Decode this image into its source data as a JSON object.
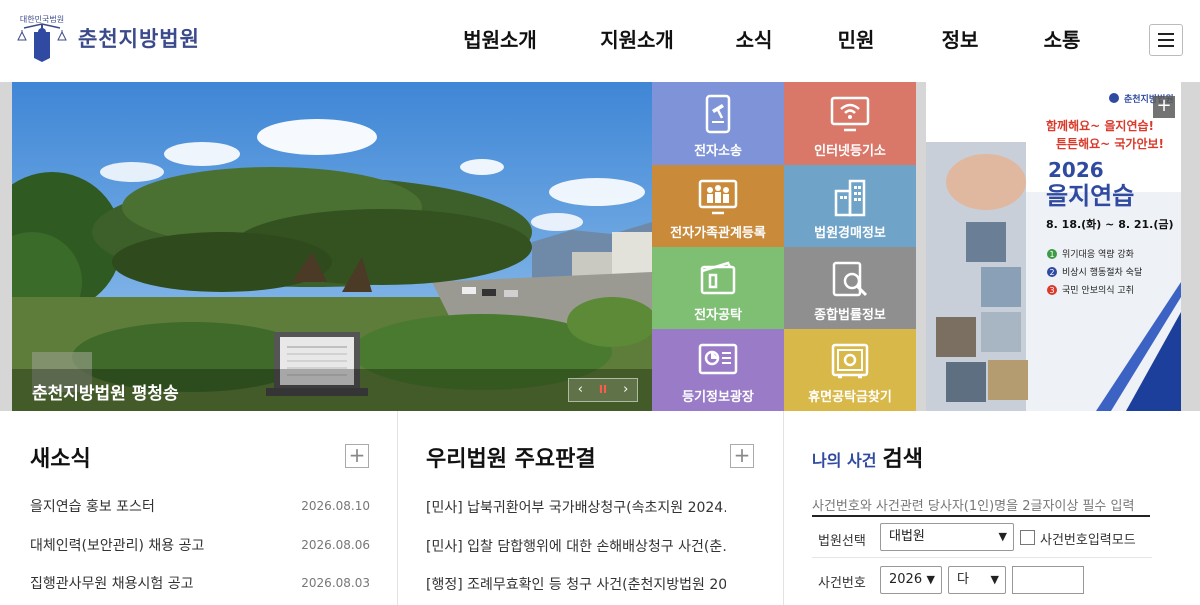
{
  "header": {
    "logo_text": "춘천지방법원",
    "logo_small_text": "대한민국법원",
    "nav": [
      "법원소개",
      "지원소개",
      "소식",
      "민원",
      "정보",
      "소통"
    ]
  },
  "hero": {
    "caption": "춘천지방법원 평청송",
    "slider": {
      "prev": "‹",
      "pause": "II",
      "next": "›"
    }
  },
  "tiles": [
    {
      "label": "전자소송",
      "icon": "gavel-tablet-icon",
      "color": "#7f94d8"
    },
    {
      "label": "인터넷등기소",
      "icon": "wifi-monitor-icon",
      "color": "#d97868"
    },
    {
      "label": "전자가족관계등록",
      "icon": "family-monitor-icon",
      "color": "#c98a3a"
    },
    {
      "label": "법원경매정보",
      "icon": "building-icon",
      "color": "#6fa3c8"
    },
    {
      "label": "전자공탁",
      "icon": "wallet-icon",
      "color": "#7fbf74"
    },
    {
      "label": "종합법률정보",
      "icon": "book-search-icon",
      "color": "#8f8f8f"
    },
    {
      "label": "등기정보광장",
      "icon": "chart-monitor-icon",
      "color": "#9a7bc7"
    },
    {
      "label": "휴면공탁금찾기",
      "icon": "safe-icon",
      "color": "#d9b84a"
    }
  ],
  "poster": {
    "org": "춘천지방법원",
    "slogan1": "함께해요~ 을지연습!",
    "slogan2": "튼튼해요~ 국가안보!",
    "year": "2026",
    "title": "을지연습",
    "dates": "8. 18.(화) ~ 8. 21.(금)",
    "points": [
      {
        "num": "1",
        "text": "위기대응 역량 강화",
        "color": "#3d9b46"
      },
      {
        "num": "2",
        "text": "비상시 행동절차 숙달",
        "color": "#2f4aa0"
      },
      {
        "num": "3",
        "text": "국민 안보의식 고취",
        "color": "#d93a2b"
      }
    ],
    "plus": "+"
  },
  "news": {
    "title": "새소식",
    "plus": "+",
    "items": [
      {
        "title": "을지연습 홍보 포스터",
        "date": "2026.08.10"
      },
      {
        "title": "대체인력(보안관리) 채용 공고",
        "date": "2026.08.06"
      },
      {
        "title": "집행관사무원 채용시험 공고",
        "date": "2026.08.03"
      }
    ]
  },
  "rulings": {
    "title": "우리법원 주요판결",
    "plus": "+",
    "items": [
      "[민사] 납북귀환어부 국가배상청구(속초지원 2024…",
      "[민사] 입찰 담합행위에 대한 손해배상청구 사건(춘…",
      "[행정] 조례무효확인 등 청구 사건(춘천지방법원 20…"
    ]
  },
  "case_search": {
    "title_small": "나의 사건",
    "title": "검색",
    "placeholder": "사건번호와 사건관련 당사자(1인)명을 2글자이상 필수 입력",
    "court_label": "법원선택",
    "court_value": "대법원",
    "mode_label": "사건번호입력모드",
    "number_label": "사건번호",
    "year_value": "2026",
    "type_value": "다"
  }
}
